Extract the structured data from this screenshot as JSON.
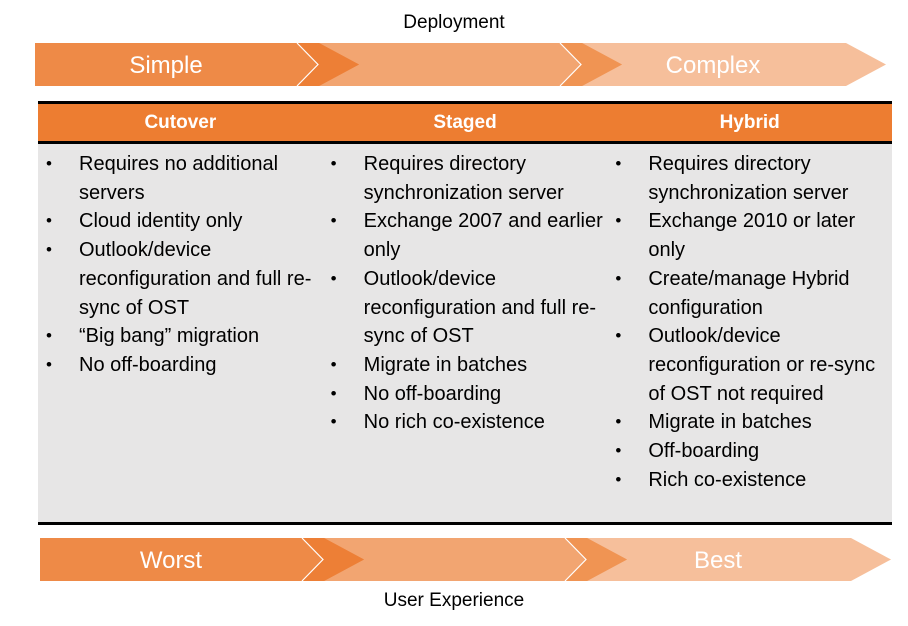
{
  "deployment": {
    "title": "Deployment",
    "stages": [
      "Simple",
      "",
      "Complex"
    ]
  },
  "user_experience": {
    "title": "User Experience",
    "stages": [
      "Worst",
      "",
      "Best"
    ]
  },
  "colors": {
    "header_orange": "#ED7D31",
    "stage1": "#EE8A47",
    "stage1_tip": "#ED7F36",
    "stage2": "#F2A571",
    "stage2_tip": "#F09453",
    "stage3": "#F6BF9B",
    "body_gray": "#E7E6E6"
  },
  "table": {
    "columns": [
      {
        "header": "Cutover",
        "items": [
          "Requires no additional servers",
          "Cloud identity only",
          "Outlook/device reconfiguration and full re-sync of OST",
          "“Big bang” migration",
          "No off-boarding"
        ]
      },
      {
        "header": "Staged",
        "items": [
          "Requires directory synchronization server",
          "Exchange 2007 and earlier only",
          "Outlook/device reconfiguration and full re-sync of OST",
          "Migrate in batches",
          "No off-boarding",
          "No rich co-existence"
        ]
      },
      {
        "header": "Hybrid",
        "items": [
          "Requires directory synchronization server",
          "Exchange 2010 or later only",
          "Create/manage Hybrid configuration",
          "Outlook/device reconfiguration or re-sync of OST not required",
          "Migrate in batches",
          "Off-boarding",
          "Rich co-existence"
        ]
      }
    ]
  }
}
